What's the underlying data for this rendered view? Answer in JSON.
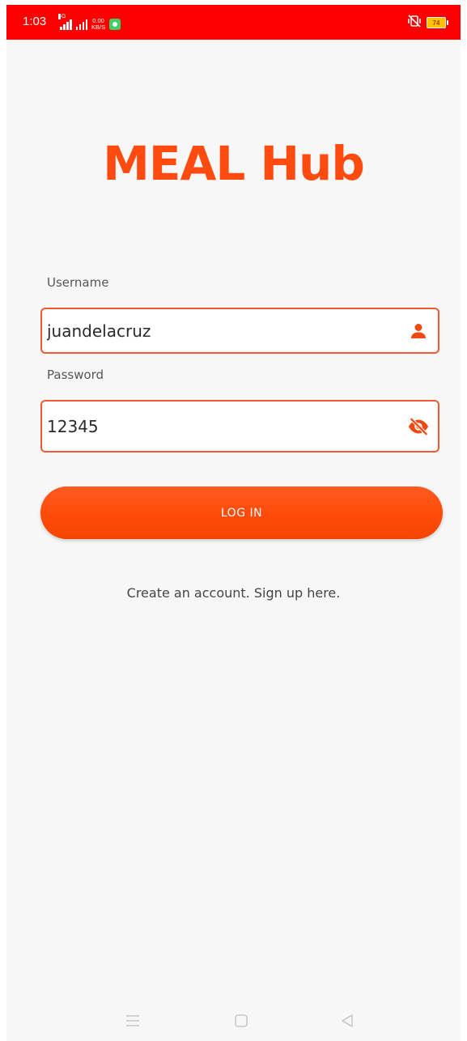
{
  "status_bar": {
    "time": "1:03",
    "net_speed_value": "0.00",
    "net_speed_unit": "KB/S",
    "network_tag": "4G",
    "battery": "74",
    "colors": {
      "background": "#ff0000"
    }
  },
  "app": {
    "title": "MEAL Hub",
    "accent_color": "#ff4a10"
  },
  "form": {
    "username_label": "Username",
    "username_value": "juandelacruz",
    "username_icon": "user-icon",
    "password_label": "Password",
    "password_value": "12345",
    "password_icon": "eye-off-icon",
    "login_label": "LOG IN",
    "signup_text": "Create an account. Sign up here."
  },
  "nav_bar": {
    "icons": [
      "menu-icon",
      "home-square-icon",
      "back-triangle-icon"
    ]
  }
}
